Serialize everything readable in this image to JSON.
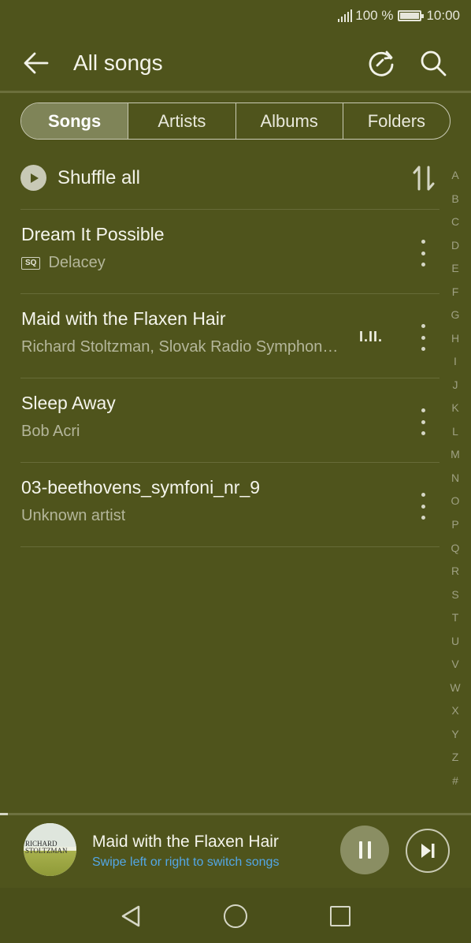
{
  "status_bar": {
    "battery_text": "100 %",
    "time": "10:00"
  },
  "header": {
    "title": "All songs"
  },
  "tabs": [
    {
      "label": "Songs",
      "active": true
    },
    {
      "label": "Artists",
      "active": false
    },
    {
      "label": "Albums",
      "active": false
    },
    {
      "label": "Folders",
      "active": false
    }
  ],
  "shuffle": {
    "label": "Shuffle all"
  },
  "songs": [
    {
      "title": "Dream It Possible",
      "artist": "Delacey",
      "badge": "SQ"
    },
    {
      "title": "Maid with the Flaxen Hair",
      "artist": "Richard Stoltzman, Slovak Radio Symphon…",
      "playing_indicator": "I.II."
    },
    {
      "title": "Sleep Away",
      "artist": "Bob Acri"
    },
    {
      "title": "03-beethovens_symfoni_nr_9",
      "artist": "Unknown artist"
    }
  ],
  "alphabet_index": [
    "A",
    "B",
    "C",
    "D",
    "E",
    "F",
    "G",
    "H",
    "I",
    "J",
    "K",
    "L",
    "M",
    "N",
    "O",
    "P",
    "Q",
    "R",
    "S",
    "T",
    "U",
    "V",
    "W",
    "X",
    "Y",
    "Z",
    "#"
  ],
  "now_playing": {
    "title": "Maid with the Flaxen Hair",
    "hint": "Swipe left or right to switch songs",
    "album_art_text": [
      "RICHARD",
      "STOLTZMAN"
    ],
    "state": "playing"
  },
  "colors": {
    "background": "#4f541c",
    "accent_hint": "#53a7e6",
    "active_tab": "#7f8458"
  },
  "icons": [
    "back-arrow-icon",
    "refresh-icon",
    "search-icon",
    "play-icon",
    "sort-icon",
    "more-vertical-icon",
    "pause-icon",
    "skip-next-icon",
    "nav-back-icon",
    "nav-home-icon",
    "nav-recent-icon"
  ]
}
